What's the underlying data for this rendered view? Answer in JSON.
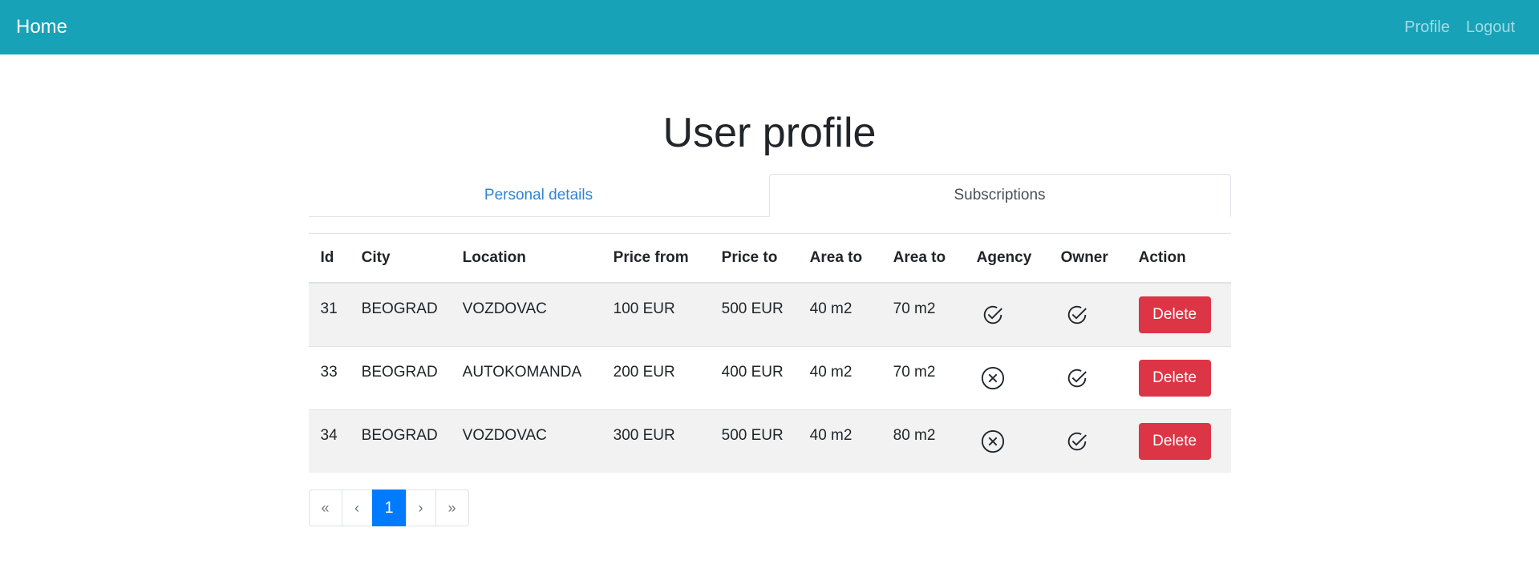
{
  "navbar": {
    "brand": "Home",
    "links": [
      "Profile",
      "Logout"
    ]
  },
  "page": {
    "title": "User profile"
  },
  "tabs": [
    {
      "label": "Personal details",
      "active": false
    },
    {
      "label": "Subscriptions",
      "active": true
    }
  ],
  "table": {
    "headers": [
      "Id",
      "City",
      "Location",
      "Price from",
      "Price to",
      "Area to",
      "Area to",
      "Agency",
      "Owner",
      "Action"
    ],
    "rows": [
      {
        "id": "31",
        "city": "BEOGRAD",
        "location": "VOZDOVAC",
        "price_from": "100 EUR",
        "price_to": "500 EUR",
        "area_from": "40 m2",
        "area_to": "70 m2",
        "agency": "check-circle-icon",
        "owner": "check-circle-icon",
        "action": "Delete"
      },
      {
        "id": "33",
        "city": "BEOGRAD",
        "location": "AUTOKOMANDA",
        "price_from": "200 EUR",
        "price_to": "400 EUR",
        "area_from": "40 m2",
        "area_to": "70 m2",
        "agency": "x-circle-icon",
        "owner": "check-circle-icon",
        "action": "Delete"
      },
      {
        "id": "34",
        "city": "BEOGRAD",
        "location": "VOZDOVAC",
        "price_from": "300 EUR",
        "price_to": "500 EUR",
        "area_from": "40 m2",
        "area_to": "80 m2",
        "agency": "x-circle-icon",
        "owner": "check-circle-icon",
        "action": "Delete"
      }
    ]
  },
  "pagination": {
    "first": "«",
    "prev": "‹",
    "current": "1",
    "next": "›",
    "last": "»"
  },
  "colors": {
    "navbar": "#17a2b8",
    "danger": "#dc3545",
    "primary": "#007bff",
    "link": "#2f84d4"
  }
}
